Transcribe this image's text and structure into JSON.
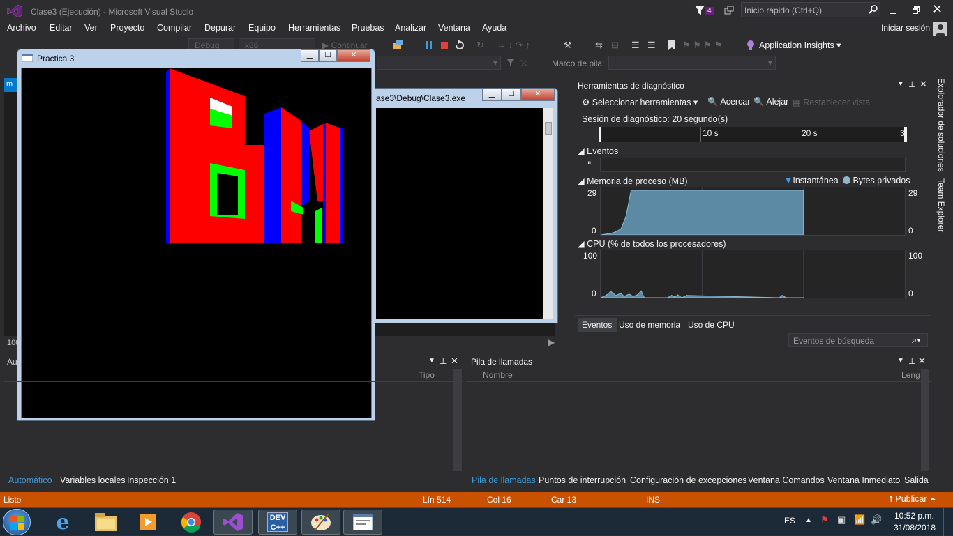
{
  "window": {
    "title": "Clase3 (Ejecución) - Microsoft Visual Studio",
    "notifications_count": "4",
    "quick_launch_placeholder": "Inicio rápido (Ctrl+Q)",
    "sign_in": "Iniciar sesión"
  },
  "menu": [
    "Archivo",
    "Editar",
    "Ver",
    "Proyecto",
    "Compilar",
    "Depurar",
    "Equipo",
    "Herramientas",
    "Pruebas",
    "Analizar",
    "Ventana",
    "Ayuda"
  ],
  "toolbar": {
    "config": "Debug",
    "platform": "x86",
    "continue": "Continuar",
    "app_insights": "Application Insights",
    "stack_frame_label": "Marco de pila:"
  },
  "practica": {
    "title": "Practica 3"
  },
  "console": {
    "title": "ase3\\Debug\\Clase3.exe"
  },
  "diagnostics": {
    "title": "Herramientas de diagnóstico",
    "select_tools": "Seleccionar herramientas",
    "zoom_in": "Acercar",
    "zoom_out": "Alejar",
    "reset_view": "Restablecer vista",
    "session": "Sesión de diagnóstico: 20 segundo(s)",
    "ticks": [
      "10 s",
      "20 s",
      "3"
    ],
    "events_label": "Eventos",
    "memory_label": "Memoria de proceso (MB)",
    "legend_snapshot": "Instantánea",
    "legend_private": "Bytes privados",
    "memory_max": "29",
    "memory_min": "0",
    "cpu_label": "CPU (% de todos los procesadores)",
    "cpu_max": "100",
    "cpu_min": "0",
    "tabs": [
      "Eventos",
      "Uso de memoria",
      "Uso de CPU"
    ],
    "search_placeholder": "Eventos de búsqueda"
  },
  "side_tabs": {
    "solution_explorer": "Explorador de soluciones",
    "team_explorer": "Team Explorer"
  },
  "autos": {
    "title_fragment": "Au",
    "col_type": "Tipo",
    "zoom_fragment": "100",
    "tabs": [
      "Automático",
      "Variables locales",
      "Inspección 1"
    ]
  },
  "callstack": {
    "title": "Pila de llamadas",
    "col_name": "Nombre",
    "col_lang": "Leng",
    "tabs": [
      "Pila de llamadas",
      "Puntos de interrupción",
      "Configuración de excepciones",
      "Ventana Comandos",
      "Ventana Inmediato",
      "Salida"
    ]
  },
  "status": {
    "state": "Listo",
    "line": "Lín 514",
    "col": "Col 16",
    "char": "Car 13",
    "ins": "INS",
    "publish": "Publicar"
  },
  "taskbar": {
    "lang": "ES",
    "time": "10:52 p.m.",
    "date": "31/08/2018",
    "dev_label": "DEV"
  },
  "colors": {
    "vs_bg": "#2d2d30",
    "status_orange": "#ca5100",
    "accent_blue": "#3e9bd8",
    "memory_fill": "#5c8aa5"
  },
  "chart_data": [
    {
      "type": "area",
      "title": "Memoria de proceso (MB)",
      "xlabel": "",
      "ylabel": "",
      "x_ticks": [
        "10 s",
        "20 s"
      ],
      "ylim": [
        0,
        29
      ],
      "series": [
        {
          "name": "Bytes privados",
          "x": [
            0,
            1,
            1.5,
            2,
            2.5,
            3,
            4,
            20
          ],
          "values": [
            0,
            1,
            2,
            4,
            12,
            29,
            29,
            29
          ]
        }
      ]
    },
    {
      "type": "area",
      "title": "CPU (% de todos los procesadores)",
      "xlabel": "",
      "ylabel": "",
      "x_ticks": [
        "10 s",
        "20 s"
      ],
      "ylim": [
        0,
        100
      ],
      "series": [
        {
          "name": "CPU",
          "x": [
            0,
            0.6,
            1,
            1.5,
            2,
            2.3,
            2.8,
            3.2,
            3.6,
            4,
            4.3,
            6.6,
            7,
            7.3,
            7.6,
            8,
            8.5,
            17.6,
            17.9,
            18.3,
            20
          ],
          "values": [
            0,
            6,
            14,
            5,
            10,
            3,
            8,
            3,
            6,
            15,
            0,
            0,
            5,
            2,
            6,
            0,
            5,
            0,
            5,
            0,
            0
          ]
        }
      ]
    }
  ]
}
